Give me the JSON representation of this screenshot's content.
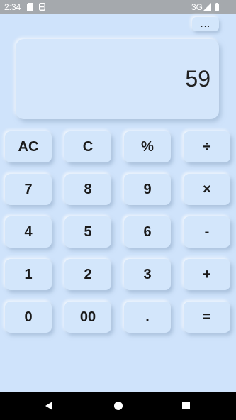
{
  "status_bar": {
    "time": "2:34",
    "network": "3G",
    "icons": [
      "sd-card-icon",
      "sync-icon",
      "signal-icon",
      "battery-icon"
    ]
  },
  "menu": {
    "label": "..."
  },
  "display": {
    "value": "59"
  },
  "keys": {
    "ac": "AC",
    "c": "C",
    "percent": "%",
    "divide": "÷",
    "seven": "7",
    "eight": "8",
    "nine": "9",
    "multiply": "×",
    "four": "4",
    "five": "5",
    "six": "6",
    "minus": "-",
    "one": "1",
    "two": "2",
    "three": "3",
    "plus": "+",
    "zero": "0",
    "double_zero": "00",
    "decimal": ".",
    "equals": "="
  },
  "nav_bar": {
    "icons": [
      "back-icon",
      "home-icon",
      "recents-icon"
    ]
  },
  "colors": {
    "background": "#cfe3fb",
    "key": "#d3e6fb",
    "status_bar": "#a5a9ad",
    "nav_bar": "#000000"
  }
}
